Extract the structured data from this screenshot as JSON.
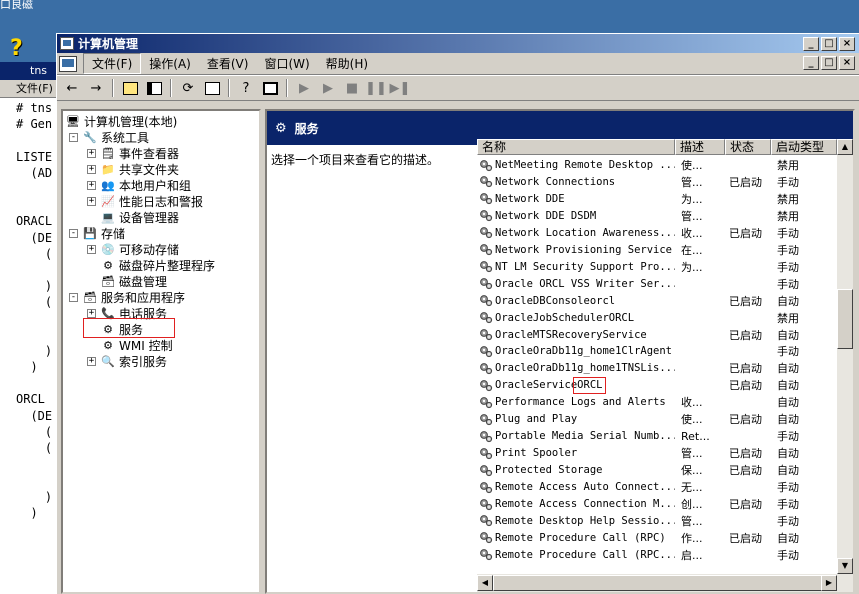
{
  "desktop": {
    "top_text": "口良磁",
    "help_glyph": "?"
  },
  "bg_window": {
    "title": "tns",
    "menu": "文件(F)",
    "code_lines": [
      "# tns",
      "# Gen",
      "",
      "LISTE",
      "  (AD",
      "",
      "",
      "ORACL",
      "  (DE",
      "    (",
      "",
      "    )",
      "    (",
      "",
      "",
      "    )",
      "  )",
      "",
      "ORCL",
      "  (DE",
      "    (",
      "    (",
      "",
      "",
      "    )",
      "  )"
    ]
  },
  "window": {
    "title": "计算机管理",
    "controls": {
      "minimize": "_",
      "maximize": "□",
      "close": "×"
    }
  },
  "menubar": {
    "items": [
      "文件(F)",
      "操作(A)",
      "查看(V)",
      "窗口(W)",
      "帮助(H)"
    ]
  },
  "tree": {
    "root": "计算机管理(本地)",
    "items": [
      {
        "label": "系统工具",
        "icon": "tools-icon"
      },
      {
        "label": "事件查看器",
        "icon": "event-viewer-icon"
      },
      {
        "label": "共享文件夹",
        "icon": "shared-folder-icon"
      },
      {
        "label": "本地用户和组",
        "icon": "users-icon"
      },
      {
        "label": "性能日志和警报",
        "icon": "perf-log-icon"
      },
      {
        "label": "设备管理器",
        "icon": "device-manager-icon"
      },
      {
        "label": "存储",
        "icon": "storage-icon"
      },
      {
        "label": "可移动存储",
        "icon": "removable-storage-icon"
      },
      {
        "label": "磁盘碎片整理程序",
        "icon": "defrag-icon"
      },
      {
        "label": "磁盘管理",
        "icon": "disk-icon"
      },
      {
        "label": "服务和应用程序",
        "icon": "services-apps-icon"
      },
      {
        "label": "电话服务",
        "icon": "phone-icon"
      },
      {
        "label": "服务",
        "icon": "services-icon"
      },
      {
        "label": "WMI 控制",
        "icon": "wmi-icon"
      },
      {
        "label": "索引服务",
        "icon": "index-icon"
      }
    ]
  },
  "panel": {
    "header": "服务",
    "description": "选择一个项目来查看它的描述。"
  },
  "list": {
    "columns": [
      "名称",
      "描述",
      "状态",
      "启动类型"
    ],
    "rows": [
      {
        "name": "NetMeeting Remote Desktop ...",
        "desc": "使...",
        "status": "",
        "startup": "禁用"
      },
      {
        "name": "Network Connections",
        "desc": "管...",
        "status": "已启动",
        "startup": "手动"
      },
      {
        "name": "Network DDE",
        "desc": "为...",
        "status": "",
        "startup": "禁用"
      },
      {
        "name": "Network DDE DSDM",
        "desc": "管...",
        "status": "",
        "startup": "禁用"
      },
      {
        "name": "Network Location Awareness...",
        "desc": "收...",
        "status": "已启动",
        "startup": "手动"
      },
      {
        "name": "Network Provisioning Service",
        "desc": "在...",
        "status": "",
        "startup": "手动"
      },
      {
        "name": "NT LM Security Support Pro...",
        "desc": "为...",
        "status": "",
        "startup": "手动"
      },
      {
        "name": "Oracle ORCL VSS Writer Ser...",
        "desc": "",
        "status": "",
        "startup": "手动"
      },
      {
        "name": "OracleDBConsoleorcl",
        "desc": "",
        "status": "已启动",
        "startup": "自动"
      },
      {
        "name": "OracleJobSchedulerORCL",
        "desc": "",
        "status": "",
        "startup": "禁用"
      },
      {
        "name": "OracleMTSRecoveryService",
        "desc": "",
        "status": "已启动",
        "startup": "自动"
      },
      {
        "name": "OracleOraDb11g_home1ClrAgent",
        "desc": "",
        "status": "",
        "startup": "手动"
      },
      {
        "name": "OracleOraDb11g_home1TNSLis...",
        "desc": "",
        "status": "已启动",
        "startup": "自动"
      },
      {
        "name": "OracleServiceORCL",
        "desc": "",
        "status": "已启动",
        "startup": "自动"
      },
      {
        "name": "Performance Logs and Alerts",
        "desc": "收...",
        "status": "",
        "startup": "自动"
      },
      {
        "name": "Plug and Play",
        "desc": "使...",
        "status": "已启动",
        "startup": "自动"
      },
      {
        "name": "Portable Media Serial Numb...",
        "desc": "Ret...",
        "status": "",
        "startup": "手动"
      },
      {
        "name": "Print Spooler",
        "desc": "管...",
        "status": "已启动",
        "startup": "自动"
      },
      {
        "name": "Protected Storage",
        "desc": "保...",
        "status": "已启动",
        "startup": "自动"
      },
      {
        "name": "Remote Access Auto Connect...",
        "desc": "无...",
        "status": "",
        "startup": "手动"
      },
      {
        "name": "Remote Access Connection M...",
        "desc": "创...",
        "status": "已启动",
        "startup": "手动"
      },
      {
        "name": "Remote Desktop Help Sessio...",
        "desc": "管...",
        "status": "",
        "startup": "手动"
      },
      {
        "name": "Remote Procedure Call (RPC)",
        "desc": "作...",
        "status": "已启动",
        "startup": "自动"
      },
      {
        "name": "Remote Procedure Call (RPC...",
        "desc": "启...",
        "status": "",
        "startup": "手动"
      }
    ]
  },
  "colors": {
    "title_dark": "#0a246a",
    "title_light": "#a6caf0",
    "highlight_red": "#e02020",
    "chrome": "#d4d0c8"
  }
}
